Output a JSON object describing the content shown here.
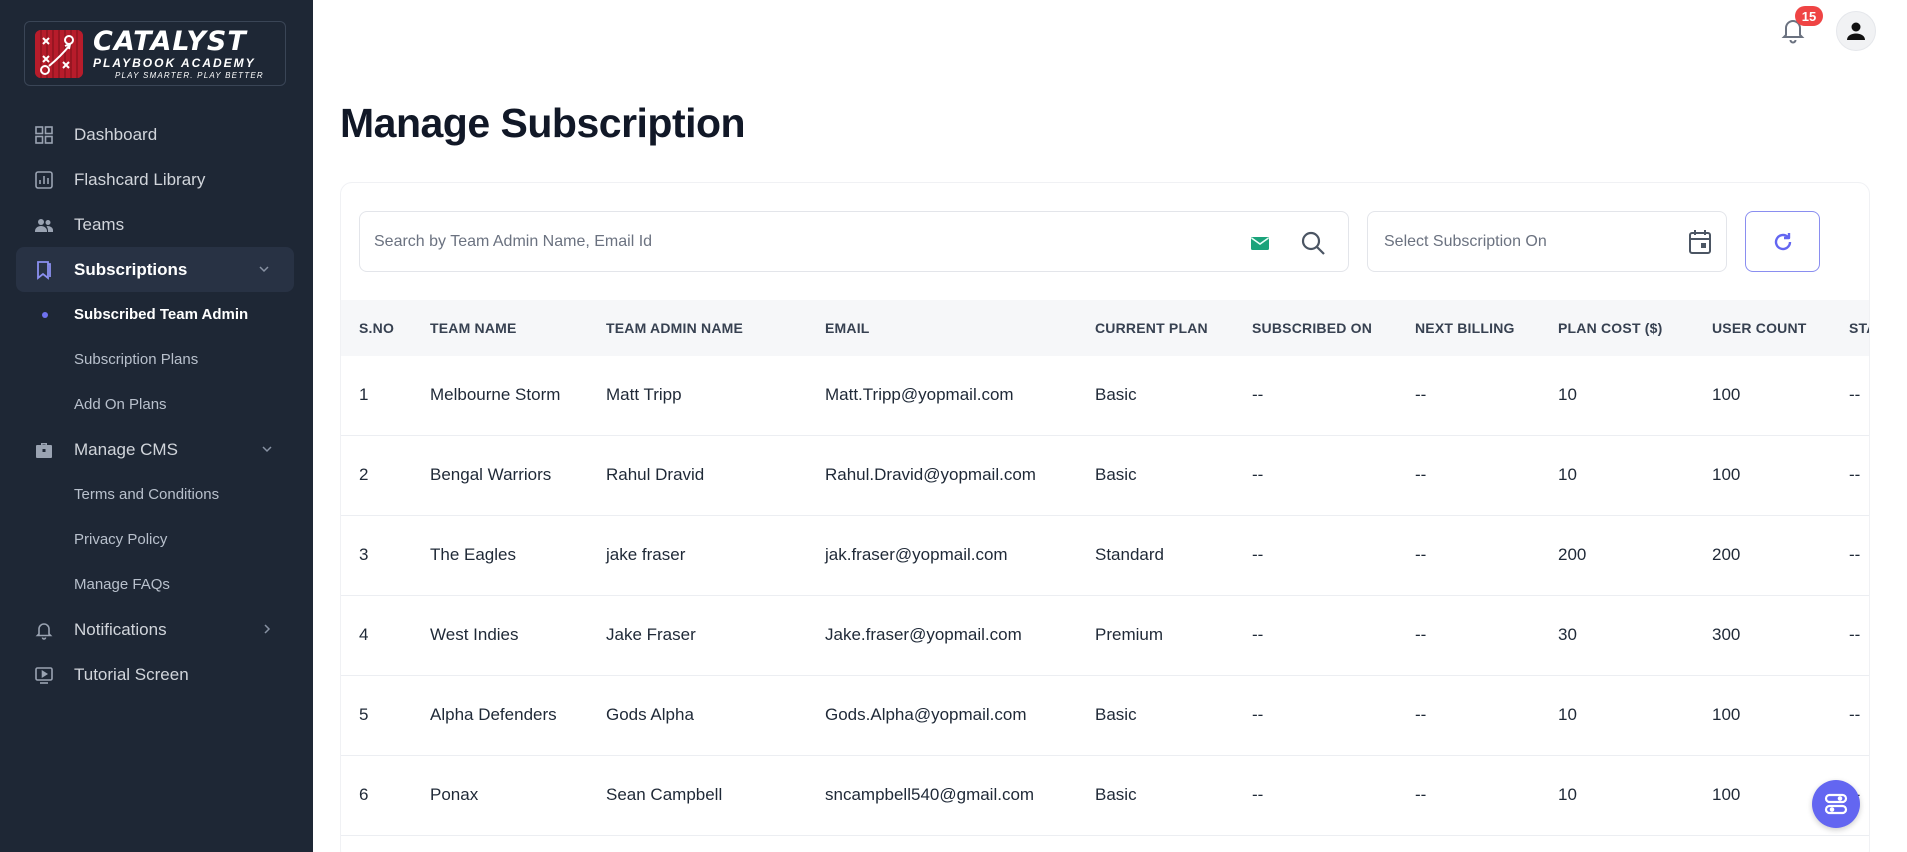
{
  "brand": {
    "title": "CATALYST",
    "subtitle": "PLAYBOOK ACADEMY",
    "tagline": "PLAY SMARTER. PLAY BETTER"
  },
  "nav": {
    "dashboard": "Dashboard",
    "flashcard": "Flashcard Library",
    "teams": "Teams",
    "subscriptions": "Subscriptions",
    "subscriptions_sub": [
      "Subscribed Team Admin",
      "Subscription Plans",
      "Add On Plans"
    ],
    "manage_cms": "Manage CMS",
    "cms_sub": [
      "Terms and Conditions",
      "Privacy Policy",
      "Manage FAQs"
    ],
    "notifications": "Notifications",
    "tutorial": "Tutorial Screen"
  },
  "topbar": {
    "notification_count": "15"
  },
  "page": {
    "title": "Manage Subscription"
  },
  "filters": {
    "search_placeholder": "Search by Team Admin Name, Email Id",
    "date_placeholder": "Select Subscription On"
  },
  "table": {
    "headers": [
      "S.NO",
      "TEAM NAME",
      "TEAM ADMIN NAME",
      "EMAIL",
      "CURRENT PLAN",
      "SUBSCRIBED ON",
      "NEXT BILLING",
      "PLAN COST ($)",
      "USER COUNT",
      "STA"
    ],
    "rows": [
      [
        "1",
        "Melbourne Storm",
        "Matt Tripp",
        "Matt.Tripp@yopmail.com",
        "Basic",
        "--",
        "--",
        "10",
        "100",
        "--"
      ],
      [
        "2",
        "Bengal Warriors",
        "Rahul Dravid",
        "Rahul.Dravid@yopmail.com",
        "Basic",
        "--",
        "--",
        "10",
        "100",
        "--"
      ],
      [
        "3",
        "The Eagles",
        "jake fraser",
        "jak.fraser@yopmail.com",
        "Standard",
        "--",
        "--",
        "200",
        "200",
        "--"
      ],
      [
        "4",
        "West Indies",
        "Jake Fraser",
        "Jake.fraser@yopmail.com",
        "Premium",
        "--",
        "--",
        "30",
        "300",
        "--"
      ],
      [
        "5",
        "Alpha Defenders",
        "Gods Alpha",
        "Gods.Alpha@yopmail.com",
        "Basic",
        "--",
        "--",
        "10",
        "100",
        "--"
      ],
      [
        "6",
        "Ponax",
        "Sean Campbell",
        "sncampbell540@gmail.com",
        "Basic",
        "--",
        "--",
        "10",
        "100",
        "--"
      ]
    ]
  },
  "colors": {
    "sidebar": "#1e2735",
    "accent": "#6366f1",
    "badge": "#ef4444"
  }
}
